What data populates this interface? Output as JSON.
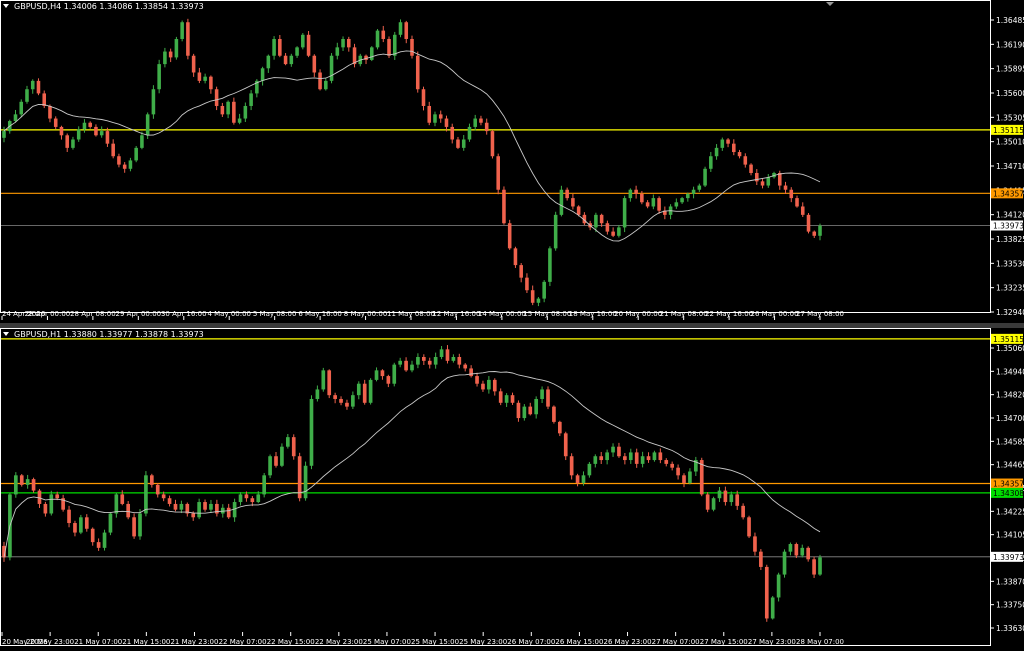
{
  "colors": {
    "background": "#000000",
    "frame": "#ffffff",
    "text": "#ffffff",
    "bull": "#3fae49",
    "bear": "#f0624d",
    "ma": "#c8c8c8",
    "bid": "#8a8a8a"
  },
  "chart_data": [
    {
      "type": "candlestick",
      "title": "GBPUSD,H4  1.34006 1.34086 1.33854 1.33973",
      "price_scale": [
        1.3294,
        1.3657
      ],
      "y_ticks": [
        "1.36485",
        "1.36190",
        "1.35895",
        "1.35600",
        "1.35305",
        "1.35010",
        "1.34710",
        "1.34415",
        "1.34120",
        "1.33825",
        "1.33530",
        "1.33235",
        "1.32940"
      ],
      "x_ticks": [
        "24 Apr 2026",
        "28 Apr 00:00",
        "28 Apr 08:00",
        "29 Apr 00:00",
        "30 Apr 16:00",
        "4 May 00:00",
        "5 May 08:00",
        "6 May 16:00",
        "8 May 00:00",
        "11 May 08:00",
        "12 May 16:00",
        "14 May 00:00",
        "15 May 08:00",
        "18 May 16:00",
        "20 May 00:00",
        "21 May 08:00",
        "22 May 16:00",
        "26 May 00:00",
        "27 May 08:00"
      ],
      "horizontal_lines": [
        {
          "price": 1.35115,
          "label": "1.35115",
          "color": "#ffff00"
        },
        {
          "price": 1.34357,
          "label": "1.34357",
          "color": "#ff9900"
        }
      ],
      "bid_price": {
        "price": 1.33973,
        "label": "1.33973"
      },
      "ma_period": 20,
      "closes": [
        1.351,
        1.3522,
        1.353,
        1.3545,
        1.356,
        1.357,
        1.3555,
        1.354,
        1.3525,
        1.3515,
        1.3505,
        1.349,
        1.35,
        1.3512,
        1.352,
        1.3515,
        1.3505,
        1.351,
        1.3495,
        1.348,
        1.347,
        1.3465,
        1.3475,
        1.349,
        1.3505,
        1.353,
        1.356,
        1.359,
        1.3605,
        1.3598,
        1.362,
        1.364,
        1.36,
        1.358,
        1.357,
        1.3575,
        1.356,
        1.354,
        1.353,
        1.3545,
        1.352,
        1.3525,
        1.354,
        1.3555,
        1.357,
        1.3585,
        1.36,
        1.362,
        1.36,
        1.359,
        1.36,
        1.361,
        1.3625,
        1.36,
        1.358,
        1.356,
        1.357,
        1.36,
        1.361,
        1.362,
        1.361,
        1.359,
        1.36,
        1.3595,
        1.361,
        1.363,
        1.362,
        1.36,
        1.3625,
        1.364,
        1.362,
        1.36,
        1.356,
        1.354,
        1.352,
        1.353,
        1.3525,
        1.3515,
        1.35,
        1.349,
        1.35,
        1.3515,
        1.3525,
        1.352,
        1.351,
        1.348,
        1.344,
        1.34,
        1.337,
        1.335,
        1.3335,
        1.332,
        1.3305,
        1.331,
        1.333,
        1.337,
        1.341,
        1.344,
        1.343,
        1.342,
        1.341,
        1.34,
        1.3395,
        1.341,
        1.34,
        1.339,
        1.3385,
        1.3395,
        1.343,
        1.344,
        1.3435,
        1.3425,
        1.342,
        1.343,
        1.3415,
        1.341,
        1.342,
        1.3425,
        1.343,
        1.3435,
        1.344,
        1.3445,
        1.3465,
        1.348,
        1.349,
        1.35,
        1.3495,
        1.3485,
        1.348,
        1.347,
        1.346,
        1.345,
        1.3445,
        1.3455,
        1.346,
        1.3445,
        1.344,
        1.343,
        1.342,
        1.341,
        1.339,
        1.3385,
        1.3397
      ]
    },
    {
      "type": "candlestick",
      "title": "GBPUSD,H1  1.33880 1.33977 1.33878 1.33973",
      "price_scale": [
        1.336,
        1.3513
      ],
      "y_ticks": [
        "1.35060",
        "1.34940",
        "1.34820",
        "1.34700",
        "1.34585",
        "1.34465",
        "1.34345",
        "1.34225",
        "1.34105",
        "1.33985",
        "1.33870",
        "1.33750",
        "1.33630"
      ],
      "x_ticks": [
        "20 May 2026",
        "20 May 23:00",
        "21 May 07:00",
        "21 May 15:00",
        "21 May 23:00",
        "22 May 07:00",
        "22 May 15:00",
        "22 May 23:00",
        "25 May 07:00",
        "25 May 15:00",
        "25 May 23:00",
        "26 May 07:00",
        "26 May 15:00",
        "26 May 23:00",
        "27 May 07:00",
        "27 May 15:00",
        "27 May 23:00",
        "28 May 07:00"
      ],
      "horizontal_lines": [
        {
          "price": 1.35115,
          "label": "1.35115",
          "color": "#ffff00"
        },
        {
          "price": 1.34357,
          "label": "1.34357",
          "color": "#ff9900"
        },
        {
          "price": 1.34308,
          "label": "1.34308",
          "color": "#00dd00"
        }
      ],
      "bid_price": {
        "price": 1.33973,
        "label": "1.33973"
      },
      "ma_period": 24,
      "closes": [
        1.3397,
        1.343,
        1.344,
        1.3435,
        1.3438,
        1.3432,
        1.3425,
        1.342,
        1.343,
        1.3428,
        1.3422,
        1.3415,
        1.341,
        1.3418,
        1.3412,
        1.3405,
        1.3402,
        1.341,
        1.342,
        1.343,
        1.3425,
        1.3418,
        1.3408,
        1.342,
        1.344,
        1.3435,
        1.343,
        1.3428,
        1.3425,
        1.3422,
        1.3425,
        1.342,
        1.3418,
        1.3426,
        1.3422,
        1.3425,
        1.342,
        1.3423,
        1.3418,
        1.3426,
        1.343,
        1.3428,
        1.3426,
        1.343,
        1.344,
        1.345,
        1.3445,
        1.3455,
        1.346,
        1.345,
        1.3428,
        1.3445,
        1.348,
        1.3485,
        1.3495,
        1.3482,
        1.348,
        1.3478,
        1.3476,
        1.3482,
        1.3488,
        1.3478,
        1.349,
        1.3495,
        1.3492,
        1.3488,
        1.3498,
        1.35,
        1.3495,
        1.3498,
        1.3502,
        1.35,
        1.3498,
        1.3502,
        1.3506,
        1.35,
        1.3502,
        1.3498,
        1.3496,
        1.3492,
        1.3488,
        1.3485,
        1.349,
        1.3484,
        1.3478,
        1.3482,
        1.3478,
        1.347,
        1.3476,
        1.3472,
        1.348,
        1.3485,
        1.3476,
        1.3468,
        1.3462,
        1.345,
        1.344,
        1.3436,
        1.344,
        1.3446,
        1.345,
        1.3448,
        1.3452,
        1.3455,
        1.345,
        1.3448,
        1.3452,
        1.3446,
        1.345,
        1.3448,
        1.3452,
        1.3448,
        1.3446,
        1.3444,
        1.344,
        1.3436,
        1.3442,
        1.3448,
        1.343,
        1.3422,
        1.3428,
        1.3432,
        1.3426,
        1.343,
        1.3424,
        1.3418,
        1.3408,
        1.34,
        1.3392,
        1.3365,
        1.3376,
        1.3388,
        1.34,
        1.3404,
        1.3398,
        1.3402,
        1.3396,
        1.3388,
        1.3397
      ]
    }
  ]
}
